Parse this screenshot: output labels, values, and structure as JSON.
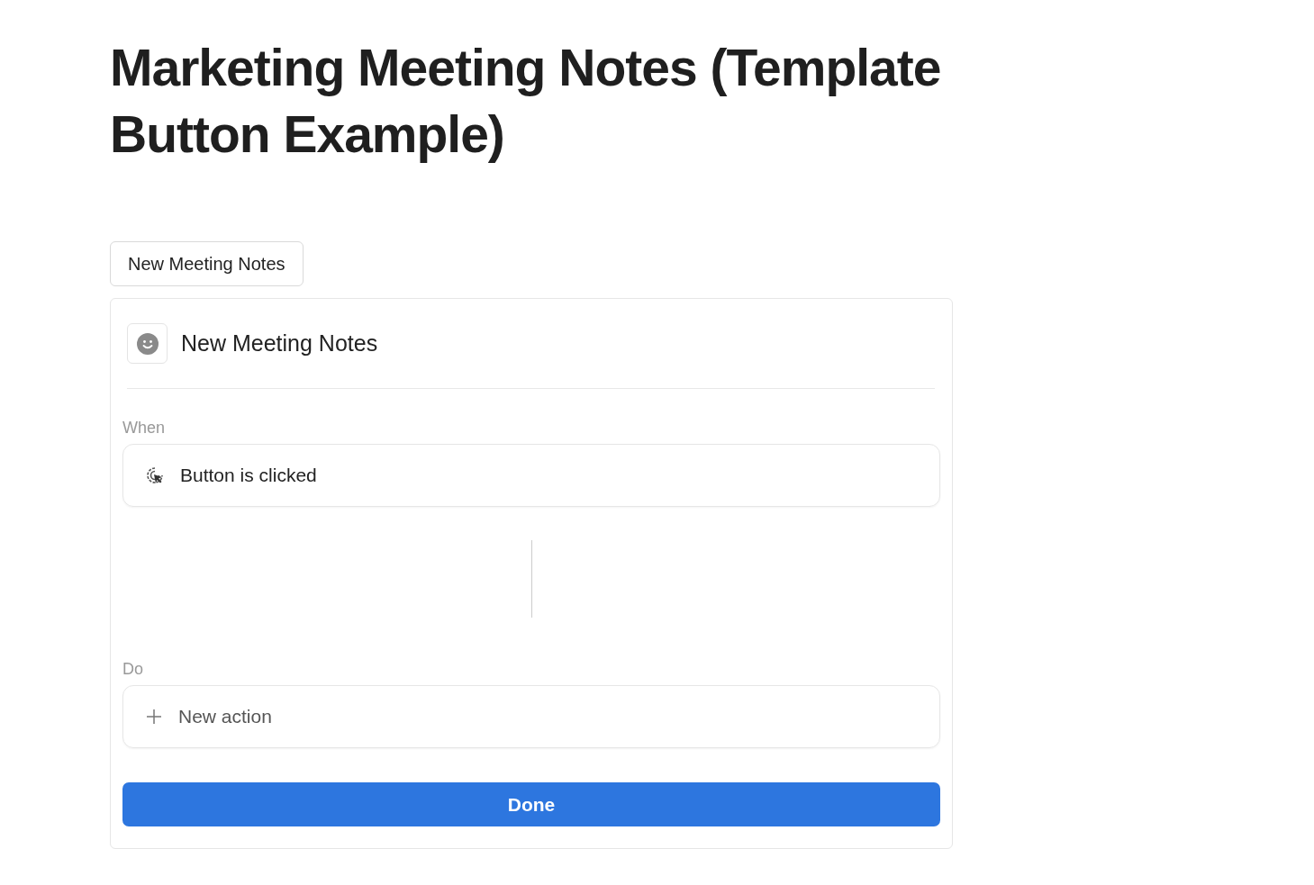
{
  "title": "Marketing Meeting Notes (Template Button Example)",
  "template_button": {
    "label": "New Meeting Notes"
  },
  "editor": {
    "name": "New Meeting Notes",
    "when": {
      "label": "When",
      "trigger": "Button is clicked"
    },
    "do": {
      "label": "Do",
      "action": "New action"
    },
    "done_button": "Done"
  }
}
